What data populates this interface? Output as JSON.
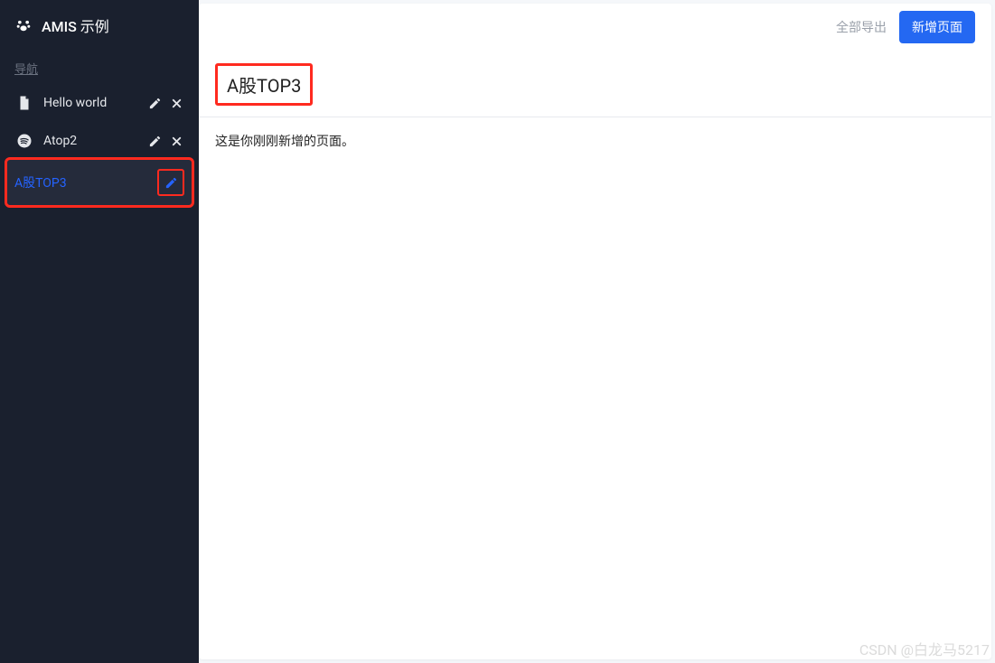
{
  "app": {
    "title": "AMIS 示例"
  },
  "sidebar": {
    "heading": "导航",
    "items": [
      {
        "label": "Hello world",
        "icon": "file-icon",
        "active": false
      },
      {
        "label": "Atop2",
        "icon": "spotify-icon",
        "active": false
      },
      {
        "label": "A股TOP3",
        "icon": "",
        "active": true
      }
    ]
  },
  "toolbar": {
    "export_all": "全部导出",
    "new_page": "新增页面"
  },
  "content": {
    "title": "A股TOP3",
    "body": "这是你刚刚新增的页面。"
  },
  "watermark": "CSDN @白龙马5217"
}
